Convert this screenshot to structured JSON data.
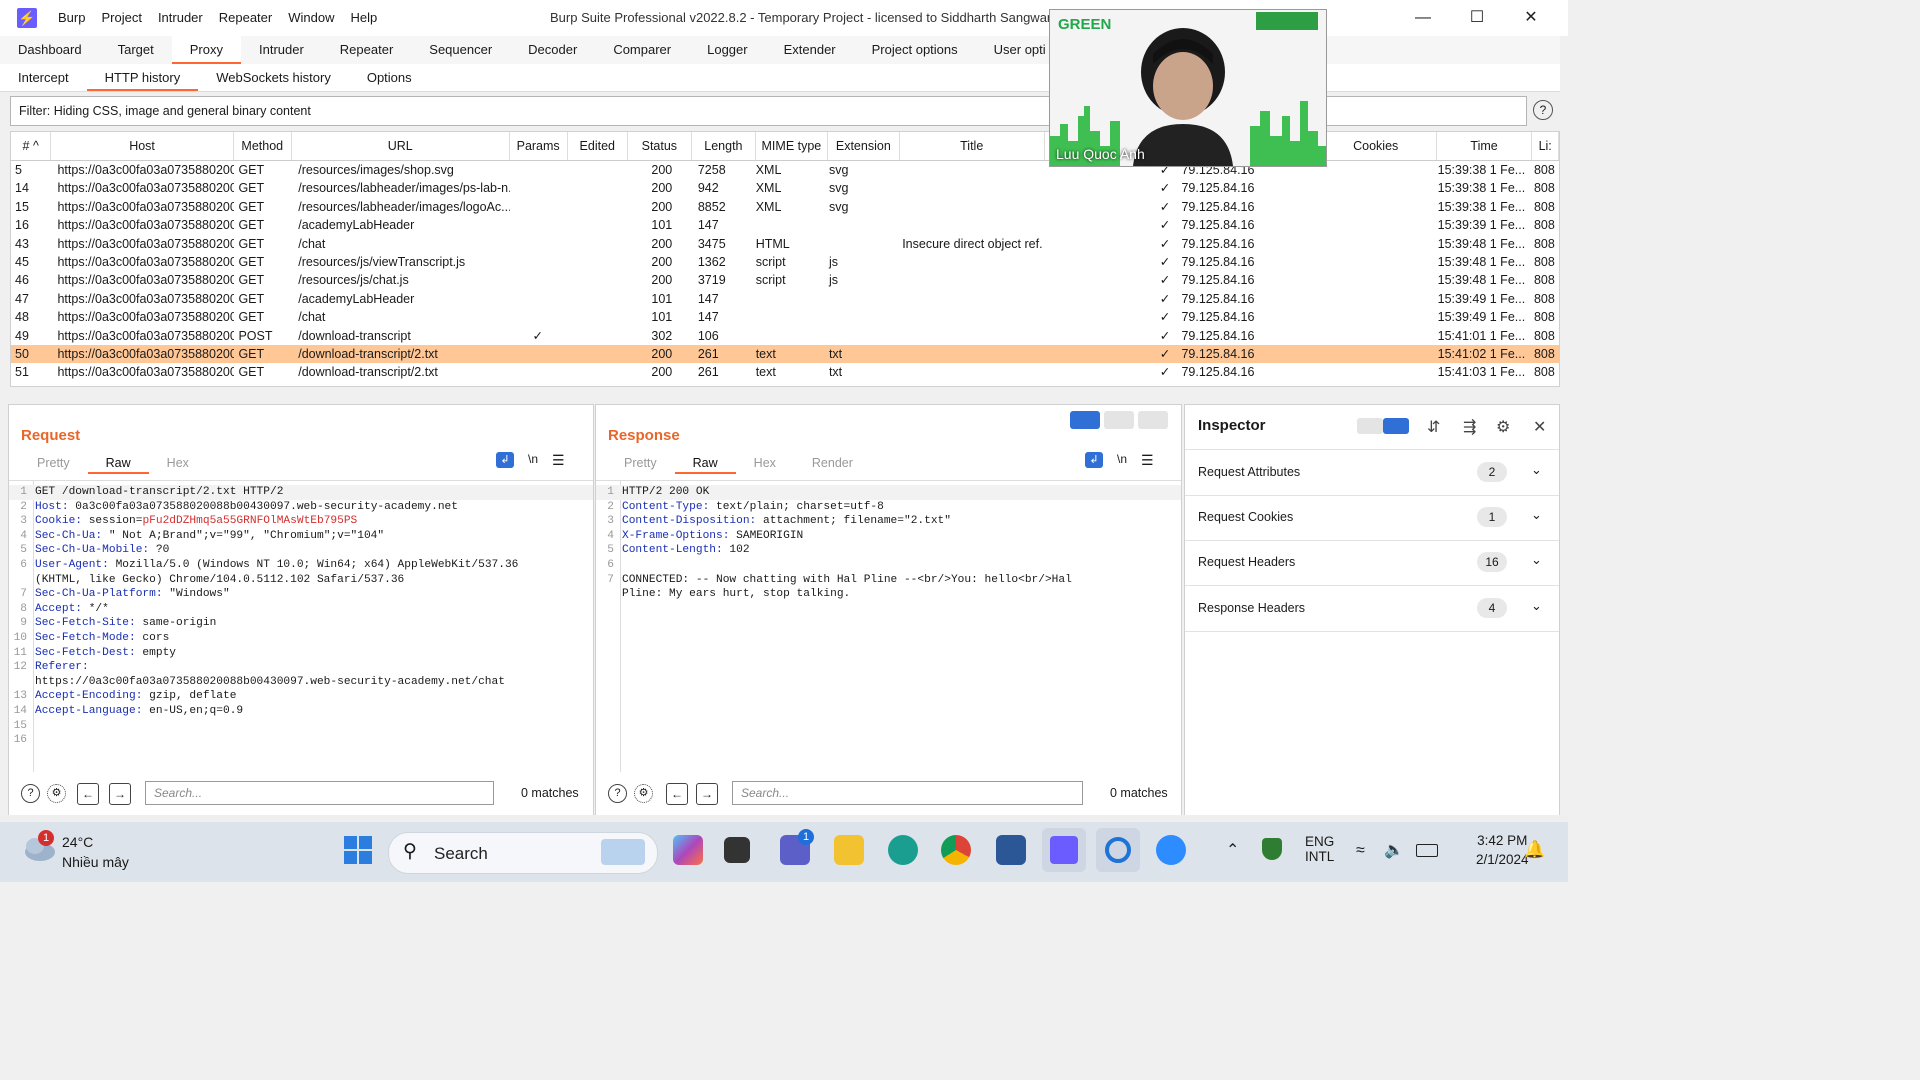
{
  "window": {
    "title": "Burp Suite Professional v2022.8.2 - Temporary Project - licensed to Siddharth Sangwan",
    "menu": [
      "Burp",
      "Project",
      "Intruder",
      "Repeater",
      "Window",
      "Help"
    ]
  },
  "main_tabs": [
    "Dashboard",
    "Target",
    "Proxy",
    "Intruder",
    "Repeater",
    "Sequencer",
    "Decoder",
    "Comparer",
    "Logger",
    "Extender",
    "Project options",
    "User opti"
  ],
  "main_tab_active": "Proxy",
  "sub_tabs": [
    "Intercept",
    "HTTP history",
    "WebSockets history",
    "Options"
  ],
  "sub_tab_active": "HTTP history",
  "filter": {
    "text": "Filter: Hiding CSS, image and general binary content"
  },
  "table": {
    "columns": [
      "# ^",
      "Host",
      "Method",
      "URL",
      "Params",
      "Edited",
      "Status",
      "Length",
      "MIME type",
      "Extension",
      "Title",
      "",
      "",
      "",
      "Cookies",
      "Time",
      "Li:"
    ],
    "rows": [
      {
        "id": "5",
        "host": "https://0a3c00fa03a0735880200...",
        "method": "GET",
        "url": "/resources/images/shop.svg",
        "params": "",
        "status": "200",
        "length": "7258",
        "mime": "XML",
        "ext": "svg",
        "title": "",
        "tls": "✓",
        "ip": "79.125.84.16",
        "time": "15:39:38 1 Fe...",
        "port": "808"
      },
      {
        "id": "14",
        "host": "https://0a3c00fa03a0735880200...",
        "method": "GET",
        "url": "/resources/labheader/images/ps-lab-n...",
        "params": "",
        "status": "200",
        "length": "942",
        "mime": "XML",
        "ext": "svg",
        "title": "",
        "tls": "✓",
        "ip": "79.125.84.16",
        "time": "15:39:38 1 Fe...",
        "port": "808"
      },
      {
        "id": "15",
        "host": "https://0a3c00fa03a0735880200...",
        "method": "GET",
        "url": "/resources/labheader/images/logoAc...",
        "params": "",
        "status": "200",
        "length": "8852",
        "mime": "XML",
        "ext": "svg",
        "title": "",
        "tls": "✓",
        "ip": "79.125.84.16",
        "time": "15:39:38 1 Fe...",
        "port": "808"
      },
      {
        "id": "16",
        "host": "https://0a3c00fa03a0735880200...",
        "method": "GET",
        "url": "/academyLabHeader",
        "params": "",
        "status": "101",
        "length": "147",
        "mime": "",
        "ext": "",
        "title": "",
        "tls": "✓",
        "ip": "79.125.84.16",
        "time": "15:39:39 1 Fe...",
        "port": "808"
      },
      {
        "id": "43",
        "host": "https://0a3c00fa03a0735880200...",
        "method": "GET",
        "url": "/chat",
        "params": "",
        "status": "200",
        "length": "3475",
        "mime": "HTML",
        "ext": "",
        "title": "Insecure direct object ref...",
        "tls": "✓",
        "ip": "79.125.84.16",
        "time": "15:39:48 1 Fe...",
        "port": "808"
      },
      {
        "id": "45",
        "host": "https://0a3c00fa03a0735880200...",
        "method": "GET",
        "url": "/resources/js/viewTranscript.js",
        "params": "",
        "status": "200",
        "length": "1362",
        "mime": "script",
        "ext": "js",
        "title": "",
        "tls": "✓",
        "ip": "79.125.84.16",
        "time": "15:39:48 1 Fe...",
        "port": "808"
      },
      {
        "id": "46",
        "host": "https://0a3c00fa03a0735880200...",
        "method": "GET",
        "url": "/resources/js/chat.js",
        "params": "",
        "status": "200",
        "length": "3719",
        "mime": "script",
        "ext": "js",
        "title": "",
        "tls": "✓",
        "ip": "79.125.84.16",
        "time": "15:39:48 1 Fe...",
        "port": "808"
      },
      {
        "id": "47",
        "host": "https://0a3c00fa03a0735880200...",
        "method": "GET",
        "url": "/academyLabHeader",
        "params": "",
        "status": "101",
        "length": "147",
        "mime": "",
        "ext": "",
        "title": "",
        "tls": "✓",
        "ip": "79.125.84.16",
        "time": "15:39:49 1 Fe...",
        "port": "808"
      },
      {
        "id": "48",
        "host": "https://0a3c00fa03a0735880200...",
        "method": "GET",
        "url": "/chat",
        "params": "",
        "status": "101",
        "length": "147",
        "mime": "",
        "ext": "",
        "title": "",
        "tls": "✓",
        "ip": "79.125.84.16",
        "time": "15:39:49 1 Fe...",
        "port": "808"
      },
      {
        "id": "49",
        "host": "https://0a3c00fa03a0735880200...",
        "method": "POST",
        "url": "/download-transcript",
        "params": "✓",
        "status": "302",
        "length": "106",
        "mime": "",
        "ext": "",
        "title": "",
        "tls": "✓",
        "ip": "79.125.84.16",
        "time": "15:41:01 1 Fe...",
        "port": "808"
      },
      {
        "id": "50",
        "host": "https://0a3c00fa03a0735880200...",
        "method": "GET",
        "url": "/download-transcript/2.txt",
        "params": "",
        "status": "200",
        "length": "261",
        "mime": "text",
        "ext": "txt",
        "title": "",
        "tls": "✓",
        "ip": "79.125.84.16",
        "time": "15:41:02 1 Fe...",
        "port": "808",
        "selected": true
      },
      {
        "id": "51",
        "host": "https://0a3c00fa03a0735880200...",
        "method": "GET",
        "url": "/download-transcript/2.txt",
        "params": "",
        "status": "200",
        "length": "261",
        "mime": "text",
        "ext": "txt",
        "title": "",
        "tls": "✓",
        "ip": "79.125.84.16",
        "time": "15:41:03 1 Fe...",
        "port": "808"
      }
    ]
  },
  "request": {
    "title": "Request",
    "tabs": [
      "Pretty",
      "Raw",
      "Hex"
    ],
    "active_tab": "Raw",
    "lines": [
      {
        "n": "1",
        "k": "",
        "v": "GET /download-transcript/2.txt HTTP/2"
      },
      {
        "n": "2",
        "k": "Host:",
        "v": " 0a3c00fa03a073588020088b00430097.web-security-academy.net"
      },
      {
        "n": "3",
        "k": "Cookie:",
        "v": " session=",
        "c": "pFu2dDZHmq5a55GRNFOlMAsWtEb795PS"
      },
      {
        "n": "4",
        "k": "Sec-Ch-Ua:",
        "v": " \" Not A;Brand\";v=\"99\", \"Chromium\";v=\"104\""
      },
      {
        "n": "5",
        "k": "Sec-Ch-Ua-Mobile:",
        "v": " ?0"
      },
      {
        "n": "6",
        "k": "User-Agent:",
        "v": " Mozilla/5.0 (Windows NT 10.0; Win64; x64) AppleWebKit/537.36"
      },
      {
        "n": "",
        "k": "",
        "v": "(KHTML, like Gecko) Chrome/104.0.5112.102 Safari/537.36"
      },
      {
        "n": "7",
        "k": "Sec-Ch-Ua-Platform:",
        "v": " \"Windows\""
      },
      {
        "n": "8",
        "k": "Accept:",
        "v": " */*"
      },
      {
        "n": "9",
        "k": "Sec-Fetch-Site:",
        "v": " same-origin"
      },
      {
        "n": "10",
        "k": "Sec-Fetch-Mode:",
        "v": " cors"
      },
      {
        "n": "11",
        "k": "Sec-Fetch-Dest:",
        "v": " empty"
      },
      {
        "n": "12",
        "k": "Referer:",
        "v": ""
      },
      {
        "n": "",
        "k": "",
        "v": "https://0a3c00fa03a073588020088b00430097.web-security-academy.net/chat"
      },
      {
        "n": "13",
        "k": "Accept-Encoding:",
        "v": " gzip, deflate"
      },
      {
        "n": "14",
        "k": "Accept-Language:",
        "v": " en-US,en;q=0.9"
      },
      {
        "n": "15",
        "k": "",
        "v": ""
      },
      {
        "n": "16",
        "k": "",
        "v": ""
      }
    ],
    "search_placeholder": "Search...",
    "matches": "0 matches"
  },
  "response": {
    "title": "Response",
    "tabs": [
      "Pretty",
      "Raw",
      "Hex",
      "Render"
    ],
    "active_tab": "Raw",
    "lines": [
      {
        "n": "1",
        "k": "",
        "v": "HTTP/2 200 OK"
      },
      {
        "n": "2",
        "k": "Content-Type:",
        "v": " text/plain; charset=utf-8"
      },
      {
        "n": "3",
        "k": "Content-Disposition:",
        "v": " attachment; filename=\"2.txt\""
      },
      {
        "n": "4",
        "k": "X-Frame-Options:",
        "v": " SAMEORIGIN"
      },
      {
        "n": "5",
        "k": "Content-Length:",
        "v": " 102"
      },
      {
        "n": "6",
        "k": "",
        "v": ""
      },
      {
        "n": "7",
        "k": "",
        "v": "CONNECTED: -- Now chatting with Hal Pline --<br/>You: hello<br/>Hal"
      },
      {
        "n": "",
        "k": "",
        "v": "Pline: My ears hurt, stop talking."
      }
    ],
    "search_placeholder": "Search...",
    "matches": "0 matches"
  },
  "inspector": {
    "title": "Inspector",
    "sections": [
      {
        "label": "Request Attributes",
        "count": "2"
      },
      {
        "label": "Request Cookies",
        "count": "1"
      },
      {
        "label": "Request Headers",
        "count": "16"
      },
      {
        "label": "Response Headers",
        "count": "4"
      }
    ]
  },
  "webcam": {
    "name": "Luu Quoc Anh",
    "logo_text": "GREEN"
  },
  "taskbar": {
    "weather_temp": "24°C",
    "weather_desc": "Nhiều mây",
    "weather_badge": "1",
    "search_label": "Search",
    "lang_line1": "ENG",
    "lang_line2": "INTL",
    "time": "3:42 PM",
    "date": "2/1/2024",
    "teams_badge": "1"
  },
  "colors": {
    "accent": "#ff6633",
    "selected_row": "#ffc796",
    "header_key": "#1a2fb3",
    "cookie_value": "#d42e2e",
    "burp_logo": "#6a5cff"
  }
}
